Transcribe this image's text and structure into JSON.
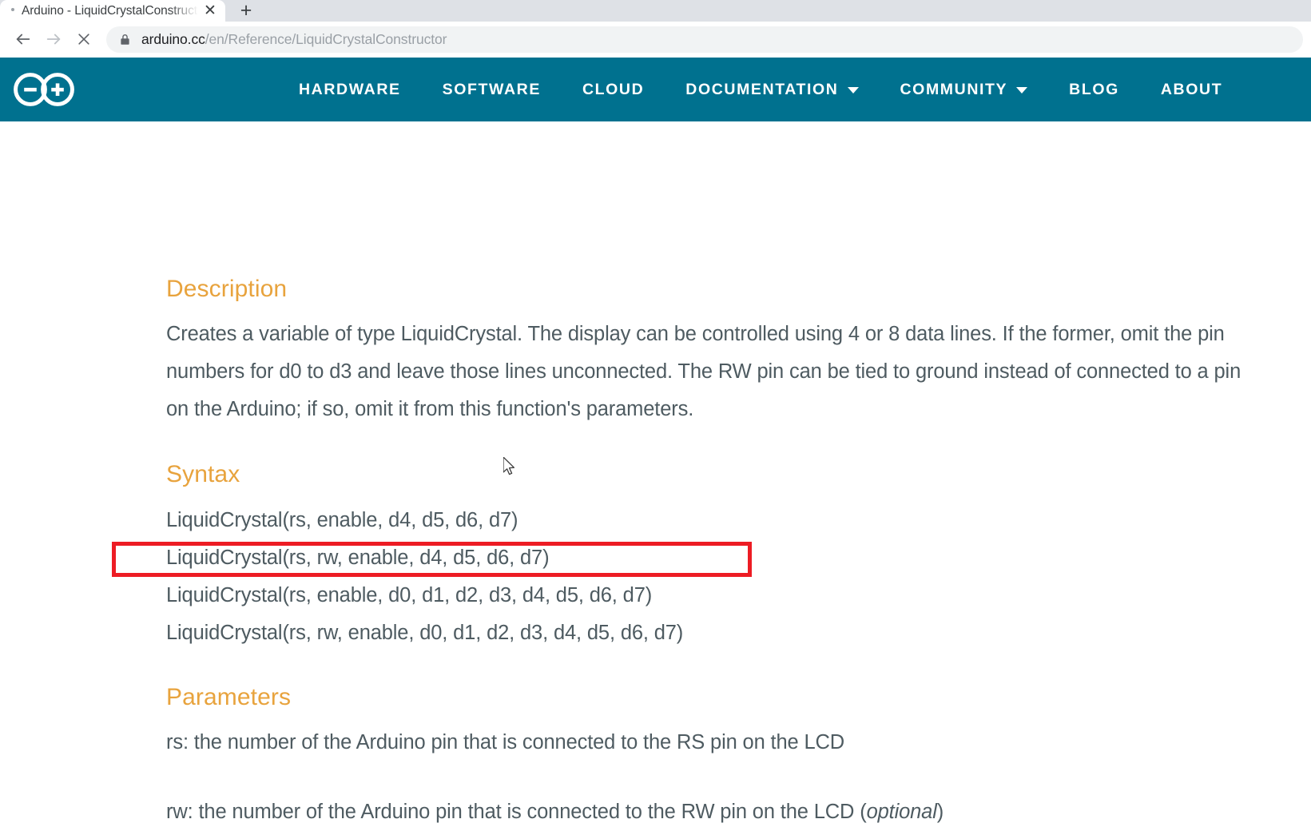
{
  "browser": {
    "tab": {
      "title": "Arduino - LiquidCrystalConstructor",
      "close_label": "✕",
      "loading_indicator": "loading-dot"
    },
    "new_tab_label": "+",
    "toolbar": {
      "back_icon": "back-arrow-icon",
      "forward_icon": "forward-arrow-icon",
      "stop_icon": "stop-loading-icon",
      "lock_icon": "lock-icon",
      "url_host": "arduino.cc",
      "url_path": "/en/Reference/LiquidCrystalConstructor",
      "url_full": "arduino.cc/en/Reference/LiquidCrystalConstructor"
    }
  },
  "site": {
    "brand": {
      "logo_name": "arduino-infinity-logo",
      "header_bg": "#00718f"
    },
    "nav": [
      {
        "label": "HARDWARE",
        "has_caret": false
      },
      {
        "label": "SOFTWARE",
        "has_caret": false
      },
      {
        "label": "CLOUD",
        "has_caret": false
      },
      {
        "label": "DOCUMENTATION",
        "has_caret": true
      },
      {
        "label": "COMMUNITY",
        "has_caret": true
      },
      {
        "label": "BLOG",
        "has_caret": false
      },
      {
        "label": "ABOUT",
        "has_caret": false
      }
    ]
  },
  "page": {
    "heading_color": "#e8a33d",
    "body_color": "#4e5b61",
    "sections": {
      "description": {
        "heading": "Description",
        "paragraph": "Creates a variable of type LiquidCrystal. The display can be controlled using 4 or 8 data lines. If the former, omit the pin numbers for d0 to d3 and leave those lines unconnected. The RW pin can be tied to ground instead of connected to a pin on the Arduino; if so, omit it from this function's parameters."
      },
      "syntax": {
        "heading": "Syntax",
        "lines": [
          "LiquidCrystal(rs, enable, d4, d5, d6, d7)",
          "LiquidCrystal(rs, rw, enable, d4, d5, d6, d7)",
          "LiquidCrystal(rs, enable, d0, d1, d2, d3, d4, d5, d6, d7)",
          "LiquidCrystal(rs, rw, enable, d0, d1, d2, d3, d4, d5, d6, d7)"
        ],
        "highlighted_line_index": 1
      },
      "parameters": {
        "heading": "Parameters",
        "items": [
          {
            "text": "rs: the number of the Arduino pin that is connected to the RS pin on the LCD",
            "optional_note": ""
          },
          {
            "text": "rw: the number of the Arduino pin that is connected to the RW pin on the LCD (",
            "optional_note": "optional",
            "suffix": ")"
          }
        ]
      }
    }
  },
  "annotation": {
    "highlight_color": "#ed1c24",
    "highlight_target": "LiquidCrystal(rs, rw, enable, d4, d5, d6, d7)"
  }
}
